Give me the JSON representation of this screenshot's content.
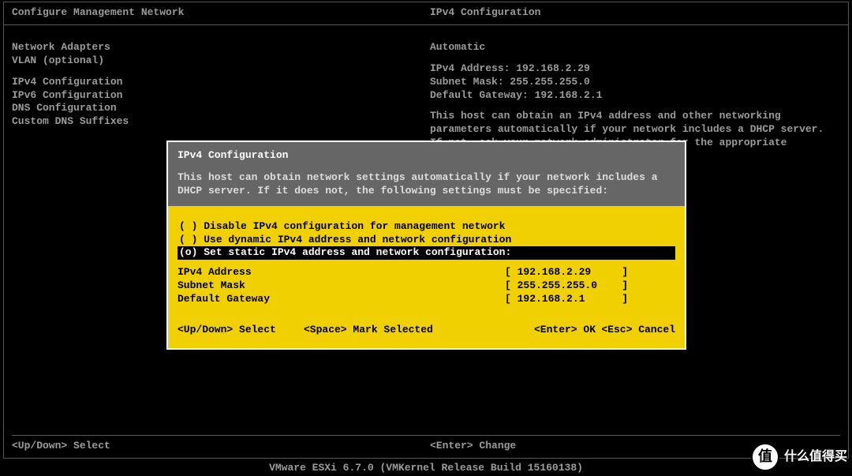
{
  "header": {
    "left_title": "Configure Management Network",
    "right_title": "IPv4 Configuration"
  },
  "left_menu": {
    "group1": [
      "Network Adapters",
      "VLAN (optional)"
    ],
    "group2": [
      "IPv4 Configuration",
      "IPv6 Configuration",
      "DNS Configuration",
      "Custom DNS Suffixes"
    ]
  },
  "right": {
    "automatic": "Automatic",
    "ipv4_address_label": "IPv4 Address: ",
    "ipv4_address_value": "192.168.2.29",
    "subnet_mask_label": "Subnet Mask: ",
    "subnet_mask_value": "255.255.255.0",
    "default_gateway_label": "Default Gateway: ",
    "default_gateway_value": "192.168.2.1",
    "desc": "This host can obtain an IPv4 address and other networking parameters automatically if your network includes a DHCP server. If not, ask your network administrator for the appropriate settings."
  },
  "footer": {
    "left_key": "<Up/Down>",
    "left_action": " Select",
    "right_key": "<Enter>",
    "right_action": " Change"
  },
  "bottom_bar": "VMware ESXi 6.7.0 (VMKernel Release Build 15160138)",
  "dialog": {
    "title": "IPv4 Configuration",
    "desc": "This host can obtain network settings automatically if your network includes a DHCP server. If it does not, the following settings must be specified:",
    "options": [
      {
        "mark": "( )",
        "label": "Disable IPv4 configuration for management network",
        "selected": false
      },
      {
        "mark": "( )",
        "label": "Use dynamic IPv4 address and network configuration",
        "selected": false
      },
      {
        "mark": "(o)",
        "label": "Set static IPv4 address and network configuration:",
        "selected": true
      }
    ],
    "fields": [
      {
        "label": "IPv4 Address",
        "value": "192.168.2.29"
      },
      {
        "label": "Subnet Mask",
        "value": "255.255.255.0"
      },
      {
        "label": "Default Gateway",
        "value": "192.168.2.1"
      }
    ],
    "hints": {
      "updown_key": "<Up/Down>",
      "updown_action": " Select",
      "space_key": "<Space>",
      "space_action": " Mark Selected",
      "enter_key": "<Enter>",
      "enter_action": " OK",
      "esc_key": "<Esc>",
      "esc_action": " Cancel"
    }
  },
  "watermark": {
    "text": "什么值得买",
    "badge": "值"
  }
}
